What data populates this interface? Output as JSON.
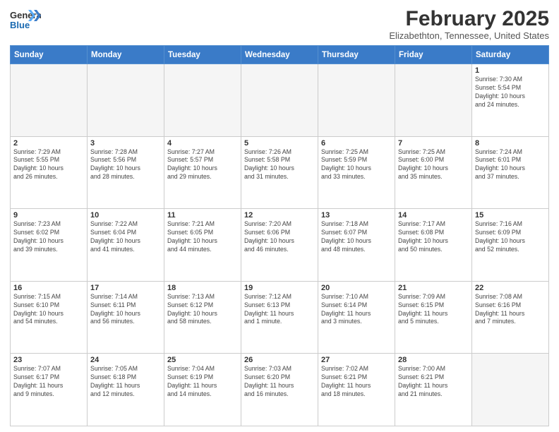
{
  "header": {
    "logo_general": "General",
    "logo_blue": "Blue",
    "month": "February 2025",
    "location": "Elizabethton, Tennessee, United States"
  },
  "days_of_week": [
    "Sunday",
    "Monday",
    "Tuesday",
    "Wednesday",
    "Thursday",
    "Friday",
    "Saturday"
  ],
  "weeks": [
    [
      {
        "day": "",
        "info": ""
      },
      {
        "day": "",
        "info": ""
      },
      {
        "day": "",
        "info": ""
      },
      {
        "day": "",
        "info": ""
      },
      {
        "day": "",
        "info": ""
      },
      {
        "day": "",
        "info": ""
      },
      {
        "day": "1",
        "info": "Sunrise: 7:30 AM\nSunset: 5:54 PM\nDaylight: 10 hours\nand 24 minutes."
      }
    ],
    [
      {
        "day": "2",
        "info": "Sunrise: 7:29 AM\nSunset: 5:55 PM\nDaylight: 10 hours\nand 26 minutes."
      },
      {
        "day": "3",
        "info": "Sunrise: 7:28 AM\nSunset: 5:56 PM\nDaylight: 10 hours\nand 28 minutes."
      },
      {
        "day": "4",
        "info": "Sunrise: 7:27 AM\nSunset: 5:57 PM\nDaylight: 10 hours\nand 29 minutes."
      },
      {
        "day": "5",
        "info": "Sunrise: 7:26 AM\nSunset: 5:58 PM\nDaylight: 10 hours\nand 31 minutes."
      },
      {
        "day": "6",
        "info": "Sunrise: 7:25 AM\nSunset: 5:59 PM\nDaylight: 10 hours\nand 33 minutes."
      },
      {
        "day": "7",
        "info": "Sunrise: 7:25 AM\nSunset: 6:00 PM\nDaylight: 10 hours\nand 35 minutes."
      },
      {
        "day": "8",
        "info": "Sunrise: 7:24 AM\nSunset: 6:01 PM\nDaylight: 10 hours\nand 37 minutes."
      }
    ],
    [
      {
        "day": "9",
        "info": "Sunrise: 7:23 AM\nSunset: 6:02 PM\nDaylight: 10 hours\nand 39 minutes."
      },
      {
        "day": "10",
        "info": "Sunrise: 7:22 AM\nSunset: 6:04 PM\nDaylight: 10 hours\nand 41 minutes."
      },
      {
        "day": "11",
        "info": "Sunrise: 7:21 AM\nSunset: 6:05 PM\nDaylight: 10 hours\nand 44 minutes."
      },
      {
        "day": "12",
        "info": "Sunrise: 7:20 AM\nSunset: 6:06 PM\nDaylight: 10 hours\nand 46 minutes."
      },
      {
        "day": "13",
        "info": "Sunrise: 7:18 AM\nSunset: 6:07 PM\nDaylight: 10 hours\nand 48 minutes."
      },
      {
        "day": "14",
        "info": "Sunrise: 7:17 AM\nSunset: 6:08 PM\nDaylight: 10 hours\nand 50 minutes."
      },
      {
        "day": "15",
        "info": "Sunrise: 7:16 AM\nSunset: 6:09 PM\nDaylight: 10 hours\nand 52 minutes."
      }
    ],
    [
      {
        "day": "16",
        "info": "Sunrise: 7:15 AM\nSunset: 6:10 PM\nDaylight: 10 hours\nand 54 minutes."
      },
      {
        "day": "17",
        "info": "Sunrise: 7:14 AM\nSunset: 6:11 PM\nDaylight: 10 hours\nand 56 minutes."
      },
      {
        "day": "18",
        "info": "Sunrise: 7:13 AM\nSunset: 6:12 PM\nDaylight: 10 hours\nand 58 minutes."
      },
      {
        "day": "19",
        "info": "Sunrise: 7:12 AM\nSunset: 6:13 PM\nDaylight: 11 hours\nand 1 minute."
      },
      {
        "day": "20",
        "info": "Sunrise: 7:10 AM\nSunset: 6:14 PM\nDaylight: 11 hours\nand 3 minutes."
      },
      {
        "day": "21",
        "info": "Sunrise: 7:09 AM\nSunset: 6:15 PM\nDaylight: 11 hours\nand 5 minutes."
      },
      {
        "day": "22",
        "info": "Sunrise: 7:08 AM\nSunset: 6:16 PM\nDaylight: 11 hours\nand 7 minutes."
      }
    ],
    [
      {
        "day": "23",
        "info": "Sunrise: 7:07 AM\nSunset: 6:17 PM\nDaylight: 11 hours\nand 9 minutes."
      },
      {
        "day": "24",
        "info": "Sunrise: 7:05 AM\nSunset: 6:18 PM\nDaylight: 11 hours\nand 12 minutes."
      },
      {
        "day": "25",
        "info": "Sunrise: 7:04 AM\nSunset: 6:19 PM\nDaylight: 11 hours\nand 14 minutes."
      },
      {
        "day": "26",
        "info": "Sunrise: 7:03 AM\nSunset: 6:20 PM\nDaylight: 11 hours\nand 16 minutes."
      },
      {
        "day": "27",
        "info": "Sunrise: 7:02 AM\nSunset: 6:21 PM\nDaylight: 11 hours\nand 18 minutes."
      },
      {
        "day": "28",
        "info": "Sunrise: 7:00 AM\nSunset: 6:21 PM\nDaylight: 11 hours\nand 21 minutes."
      },
      {
        "day": "",
        "info": ""
      }
    ]
  ]
}
